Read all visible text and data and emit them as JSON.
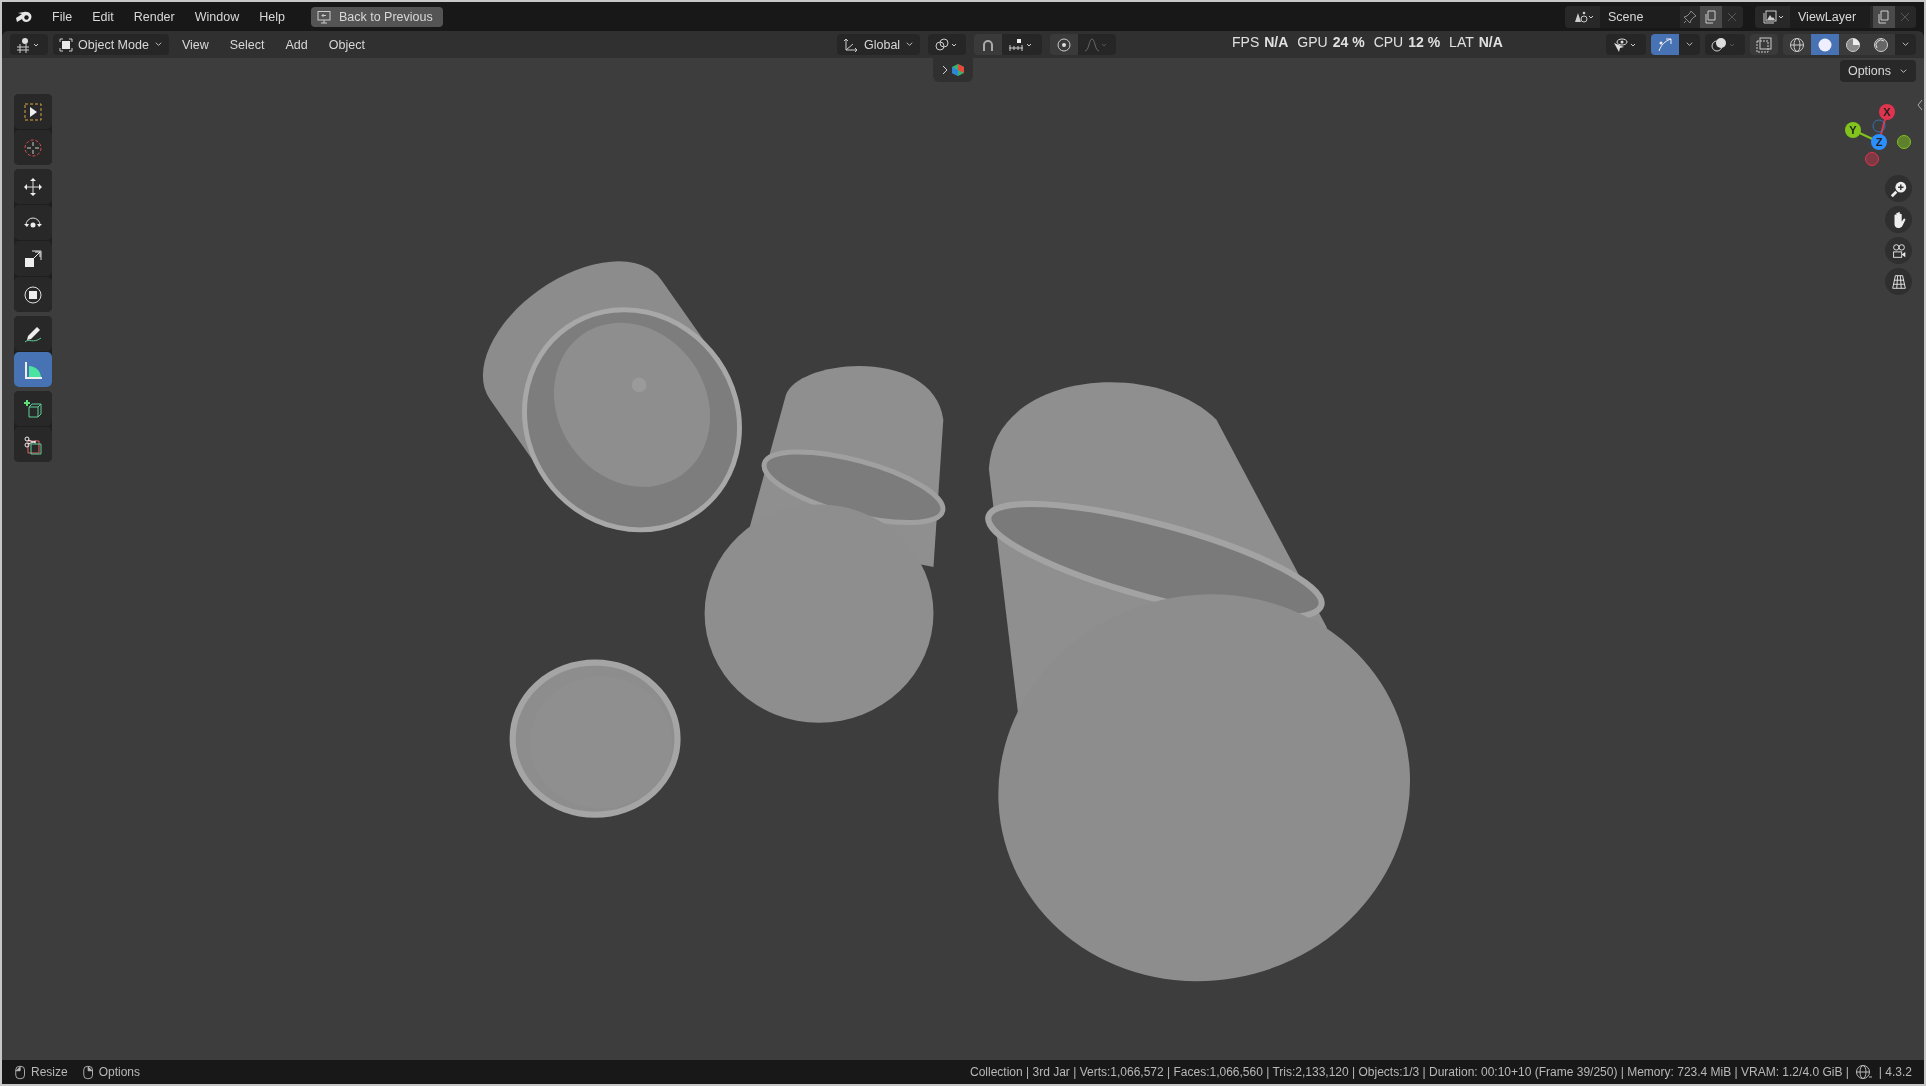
{
  "menu_bar": {
    "menus": [
      "File",
      "Edit",
      "Render",
      "Window",
      "Help"
    ],
    "back_button": "Back to Previous",
    "scene": "Scene",
    "view_layer": "ViewLayer"
  },
  "header": {
    "mode": "Object Mode",
    "menus": [
      "View",
      "Select",
      "Add",
      "Object"
    ],
    "orientation": "Global",
    "gizmo_on": true,
    "shading": [
      {
        "kind": "wireframe",
        "selected": false
      },
      {
        "kind": "solid",
        "selected": true
      },
      {
        "kind": "material",
        "selected": false
      },
      {
        "kind": "rendered",
        "selected": false
      }
    ]
  },
  "stats": [
    {
      "label": "FPS",
      "value": "N/A"
    },
    {
      "label": "GPU",
      "value": "24 %"
    },
    {
      "label": "CPU",
      "value": "12 %"
    },
    {
      "label": "LAT",
      "value": "N/A"
    }
  ],
  "toolbar": [
    [
      {
        "kind": "select_box",
        "selected": false
      },
      {
        "kind": "cursor",
        "selected": false
      }
    ],
    [
      {
        "kind": "move",
        "selected": false
      },
      {
        "kind": "rotate",
        "selected": false
      },
      {
        "kind": "scale",
        "selected": false
      },
      {
        "kind": "transform",
        "selected": false
      }
    ],
    [
      {
        "kind": "annotate",
        "selected": false
      },
      {
        "kind": "measure",
        "selected": true
      }
    ],
    [
      {
        "kind": "add_cube",
        "selected": false
      },
      {
        "kind": "cut",
        "selected": false
      }
    ]
  ],
  "viewport": {
    "options": "Options",
    "axes": [
      {
        "label": "X",
        "color": "#e0344e"
      },
      {
        "label": "Y",
        "color": "#82c41c"
      },
      {
        "label": "Z",
        "color": "#2c8fff"
      }
    ]
  },
  "status_bar": {
    "hints": [
      "Resize",
      "Options"
    ],
    "info": "Collection | 3rd Jar | Verts:1,066,572 | Faces:1,066,560 | Tris:2,133,120 | Objects:1/3 | Duration: 00:10+10 (Frame 39/250) | Memory: 723.4 MiB | VRAM: 1.2/4.0 GiB |",
    "version": "| 4.3.2"
  }
}
